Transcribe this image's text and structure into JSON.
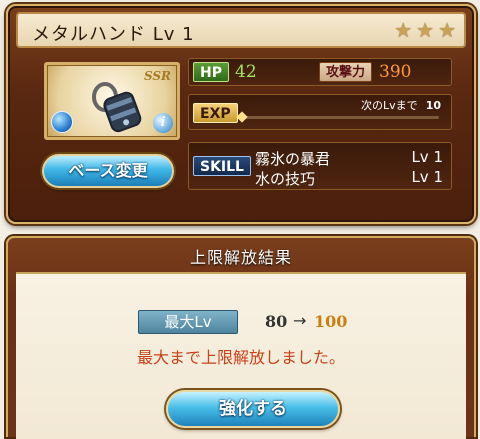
{
  "weapon": {
    "name": "メタルハンド",
    "level_label": "Lv 1",
    "rarity": "SSR",
    "uncap_stars": 3,
    "element": "water",
    "base_change_label": "ベース変更"
  },
  "stats": {
    "hp_label": "HP",
    "hp_value": "42",
    "atk_label": "攻撃力",
    "atk_value": "390",
    "exp_label": "EXP",
    "next_lv_label": "次のLvまで",
    "next_lv_value": "10",
    "exp_progress": 0
  },
  "skills": {
    "label": "SKILL",
    "items": [
      {
        "name": "霧氷の暴君",
        "level": "Lv 1"
      },
      {
        "name": "水の技巧",
        "level": "Lv 1"
      }
    ]
  },
  "result": {
    "title": "上限解放結果",
    "max_lv_label": "最大Lv",
    "old_value": "80",
    "arrow": "→",
    "new_value": "100",
    "message": "最大まで上限解放しました。",
    "enhance_label": "強化する"
  },
  "colors": {
    "hp": "#a6e35a",
    "atk": "#ff9a3a",
    "new_level": "#c98010",
    "message": "#c8421a",
    "button": "#48bfe8"
  }
}
